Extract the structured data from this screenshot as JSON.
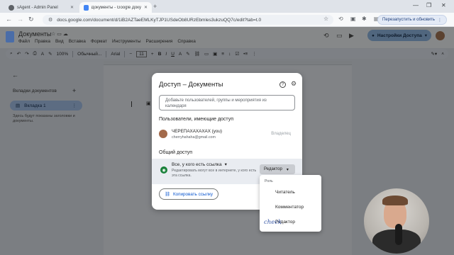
{
  "browser": {
    "tabs": [
      {
        "title": "sAgent - Admin Panel",
        "active": false
      },
      {
        "title": "Документы - Google Докумен...",
        "active": true
      }
    ],
    "url": "docs.google.com/document/d/1iB2AZTaeEMLKyTJP1USdeOb8URzEbmles3ukzuQQ7c/edit?tab=t.0",
    "relaunch_label": "Перезапустить и обновить"
  },
  "docs": {
    "title": "Документы",
    "menu": [
      "Файл",
      "Правка",
      "Вид",
      "Вставка",
      "Формат",
      "Инструменты",
      "Расширения",
      "Справка"
    ],
    "share_button": "Настройки Доступа",
    "toolbar": {
      "zoom": "100%",
      "style": "Обычный...",
      "font": "Arial",
      "font_size": "11"
    }
  },
  "side_panel": {
    "title": "Вкладки документов",
    "tab_label": "Вкладка 1",
    "hint": "Здесь будут показаны заголовки и документы."
  },
  "dialog": {
    "title": "Доступ – Документы",
    "add_placeholder": "Добавьте пользователей, группы и мероприятия из календаря",
    "people_label": "Пользователи, имеющие доступ",
    "owner_name": "ЧЕРЕПАХАХАХАХ (you)",
    "owner_email": "cherryhahaha@gmail.com",
    "owner_role": "Владелец",
    "general_label": "Общий доступ",
    "access_option": "Все, у кого есть ссылка",
    "access_desc": "Редактировать могут все в интернете, у кого есть эта ссылка.",
    "role_value": "Редактор",
    "copy_link": "Копировать ссылку"
  },
  "role_menu": {
    "header": "Роль",
    "options": [
      "Читатель",
      "Комментатор",
      "Редактор"
    ],
    "selected": "Редактор",
    "handwriting": "check"
  }
}
